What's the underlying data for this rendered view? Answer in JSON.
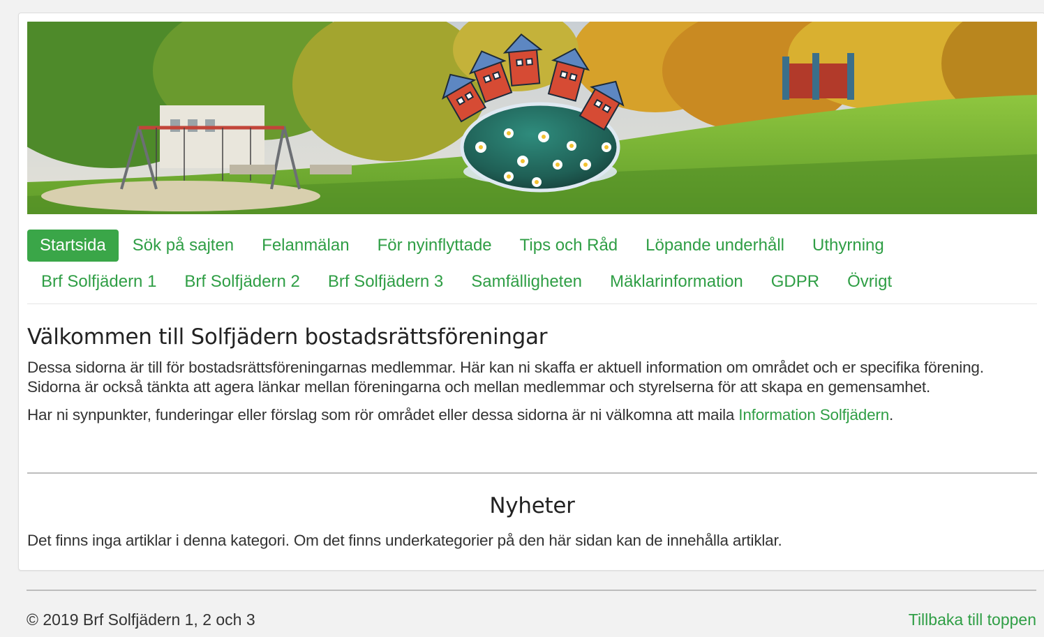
{
  "banner": {
    "alt": "Solfjädern park banner with logo"
  },
  "nav": {
    "row1": [
      {
        "label": "Startsida",
        "active": true
      },
      {
        "label": "Sök på sajten"
      },
      {
        "label": "Felanmälan"
      },
      {
        "label": "För nyinflyttade"
      },
      {
        "label": "Tips och Råd"
      },
      {
        "label": "Löpande underhåll"
      },
      {
        "label": "Uthyrning"
      }
    ],
    "row2": [
      {
        "label": "Brf Solfjädern 1"
      },
      {
        "label": "Brf Solfjädern 2"
      },
      {
        "label": "Brf Solfjädern 3"
      },
      {
        "label": "Samfälligheten"
      },
      {
        "label": "Mäklarinformation"
      },
      {
        "label": "GDPR"
      },
      {
        "label": "Övrigt"
      }
    ]
  },
  "main": {
    "title": "Välkommen till Solfjädern bostadsrättsföreningar",
    "paragraph1": "Dessa sidorna är till för bostadsrättsföreningarnas medlemmar. Här kan ni skaffa er aktuell information om området och er specifika förening. Sidorna är också tänkta att agera länkar mellan föreningarna och mellan medlemmar och styrelserna för att skapa en gemensamhet.",
    "paragraph2_text": "Har ni synpunkter, funderingar eller förslag som rör området eller dessa sidorna är ni välkomna att maila ",
    "paragraph2_link": "Information Solfjädern",
    "paragraph2_end": "."
  },
  "news": {
    "title": "Nyheter",
    "empty_text": "Det finns inga artiklar i denna kategori. Om det finns underkategorier på den här sidan kan de innehålla artiklar."
  },
  "footer": {
    "copyright": "© 2019 Brf Solfjädern 1, 2 och 3",
    "back_to_top": "Tillbaka till toppen"
  },
  "colors": {
    "accent": "#3aa648",
    "link": "#2f9e45",
    "text": "#333333",
    "background": "#f2f2f2"
  }
}
